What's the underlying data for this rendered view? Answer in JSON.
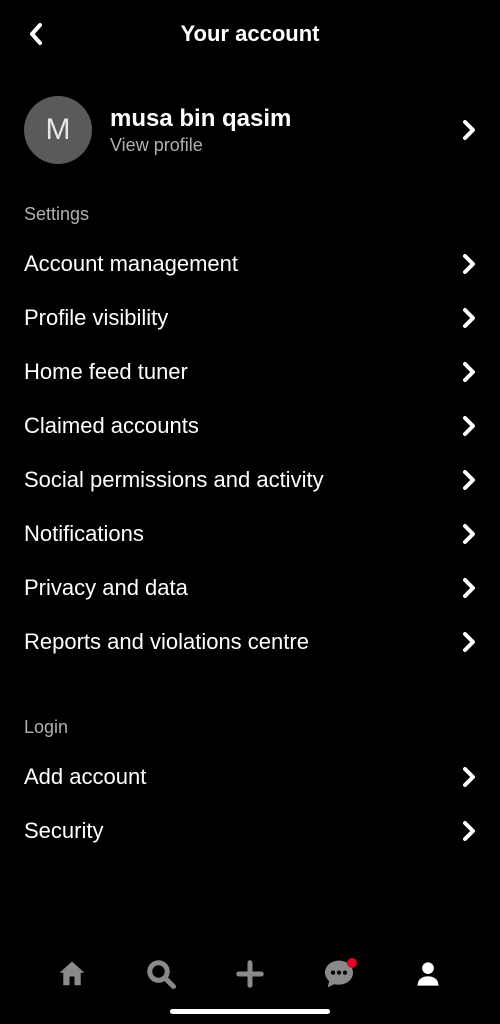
{
  "header": {
    "title": "Your account"
  },
  "profile": {
    "initial": "M",
    "name": "musa bin qasim",
    "subtitle": "View profile"
  },
  "sections": {
    "settings_label": "Settings",
    "login_label": "Login"
  },
  "settings_items": [
    {
      "label": "Account management"
    },
    {
      "label": "Profile visibility"
    },
    {
      "label": "Home feed tuner"
    },
    {
      "label": "Claimed accounts"
    },
    {
      "label": "Social permissions and activity"
    },
    {
      "label": "Notifications"
    },
    {
      "label": "Privacy and data"
    },
    {
      "label": "Reports and violations centre"
    }
  ],
  "login_items": [
    {
      "label": "Add account"
    },
    {
      "label": "Security"
    }
  ]
}
